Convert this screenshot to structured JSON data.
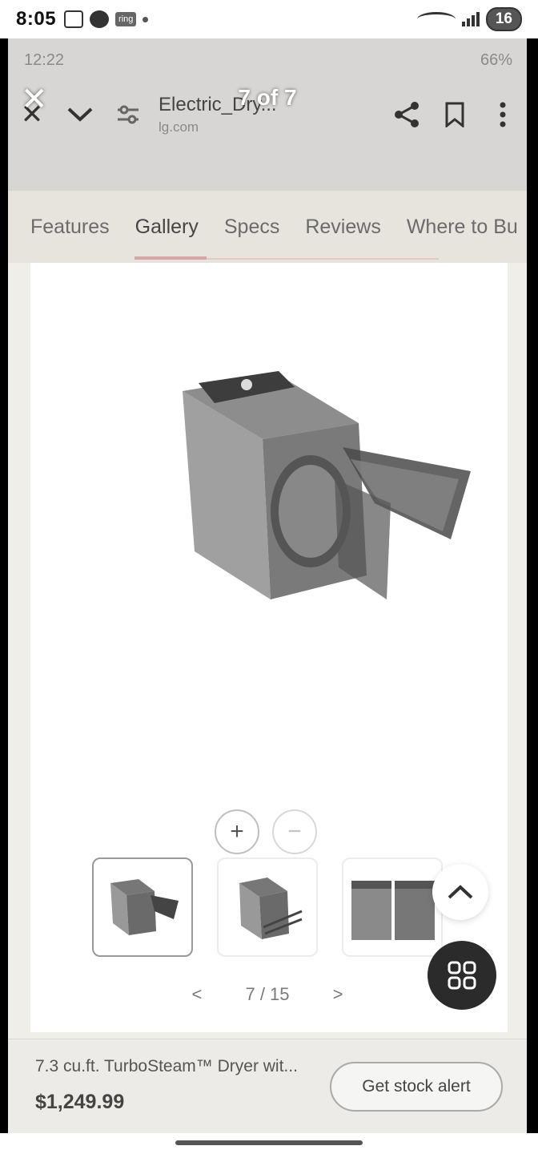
{
  "system_status": {
    "time": "8:05",
    "ring_label": "ring",
    "battery": "16"
  },
  "captured_status": {
    "time": "12:22",
    "battery": "66%"
  },
  "viewer": {
    "counter": "7 of 7"
  },
  "browser": {
    "page_title": "Electric_Dry...",
    "domain": "lg.com"
  },
  "tabs": [
    {
      "label": "Features"
    },
    {
      "label": "Gallery"
    },
    {
      "label": "Specs"
    },
    {
      "label": "Reviews"
    },
    {
      "label": "Where to Bu"
    }
  ],
  "active_tab": "Gallery",
  "gallery": {
    "zoom_in_label": "+",
    "zoom_out_label": "−",
    "page_indicator": "7 / 15",
    "prev_label": "<",
    "next_label": ">"
  },
  "product": {
    "name": "7.3 cu.ft. TurboSteam™ Dryer wit...",
    "price": "$1,249.99",
    "stock_alert_label": "Get stock alert"
  },
  "icons": [
    "x-close-icon",
    "chevron-down-icon",
    "tune-icon",
    "share-icon",
    "bookmark-icon",
    "more-vert-icon",
    "chevron-up-icon",
    "grid-icon"
  ],
  "colors": {
    "tab_accent": "#d7a6a6",
    "fab_bg": "#2b2b2b"
  }
}
